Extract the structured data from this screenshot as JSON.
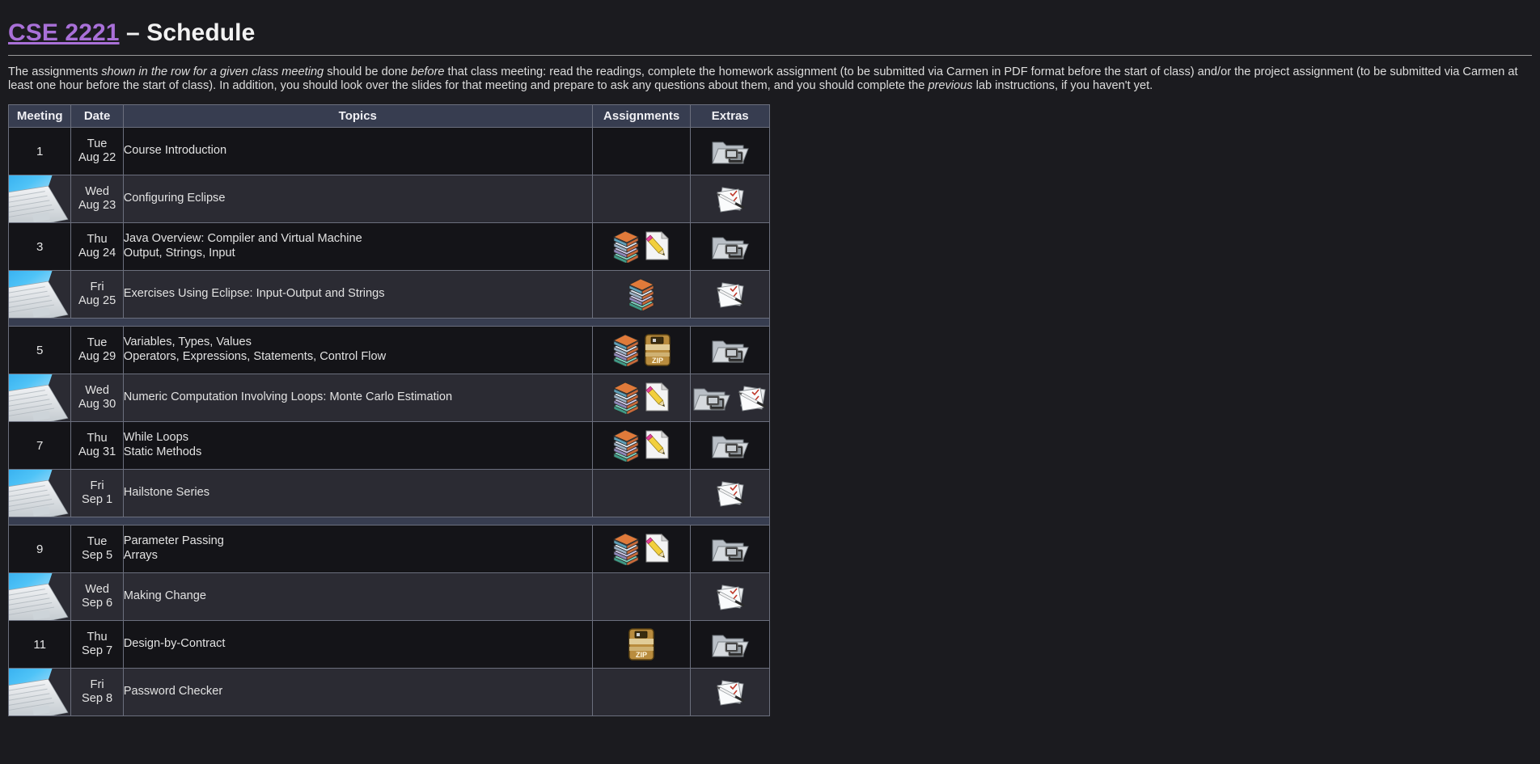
{
  "header": {
    "course_link": "CSE 2221",
    "dash_schedule": " – Schedule"
  },
  "intro": {
    "part1": "The assignments ",
    "em1": "shown in the row for a given class meeting",
    "part2": " should be done ",
    "em2": "before",
    "part3": " that class meeting: read the readings, complete the homework assignment (to be submitted via Carmen in PDF format before the start of class) and/or the project assignment (to be submitted via Carmen at least one hour before the start of class). In addition, you should look over the slides for that meeting and prepare to ask any questions about them, and you should complete the ",
    "em3": "previous",
    "part4": " lab instructions, if you haven't yet."
  },
  "table": {
    "columns": [
      {
        "key": "meeting",
        "label": "Meeting"
      },
      {
        "key": "date",
        "label": "Date"
      },
      {
        "key": "topics",
        "label": "Topics"
      },
      {
        "key": "assignments",
        "label": "Assignments"
      },
      {
        "key": "extras",
        "label": "Extras"
      }
    ],
    "rows": [
      {
        "kind": "class",
        "meeting": "1",
        "meeting_icon": null,
        "date_day": "Tue",
        "date_date": "Aug 22",
        "topics": [
          "Course Introduction"
        ],
        "assignments": [],
        "extras": [
          "slides-folder-icon"
        ]
      },
      {
        "kind": "lab",
        "meeting": "",
        "meeting_icon": "laptop-icon",
        "date_day": "Wed",
        "date_date": "Aug 23",
        "topics": [
          "Configuring Eclipse"
        ],
        "assignments": [],
        "extras": [
          "lab-instructions-icon"
        ]
      },
      {
        "kind": "class",
        "meeting": "3",
        "meeting_icon": null,
        "date_day": "Thu",
        "date_date": "Aug 24",
        "topics": [
          "Java Overview: Compiler and Virtual Machine",
          "Output, Strings, Input"
        ],
        "assignments": [
          "readings-books-icon",
          "homework-pencil-icon"
        ],
        "extras": [
          "slides-folder-icon"
        ]
      },
      {
        "kind": "lab",
        "meeting": "",
        "meeting_icon": "laptop-icon",
        "date_day": "Fri",
        "date_date": "Aug 25",
        "topics": [
          "Exercises Using Eclipse: Input-Output and Strings"
        ],
        "assignments": [
          "readings-books-icon"
        ],
        "extras": [
          "lab-instructions-icon"
        ]
      },
      {
        "kind": "separator"
      },
      {
        "kind": "class",
        "meeting": "5",
        "meeting_icon": null,
        "date_day": "Tue",
        "date_date": "Aug 29",
        "topics": [
          "Variables, Types, Values",
          "Operators, Expressions, Statements, Control Flow"
        ],
        "assignments": [
          "readings-books-icon",
          "zip-archive-icon"
        ],
        "extras": [
          "slides-folder-icon"
        ]
      },
      {
        "kind": "lab",
        "meeting": "",
        "meeting_icon": "laptop-icon",
        "date_day": "Wed",
        "date_date": "Aug 30",
        "topics": [
          "Numeric Computation Involving Loops: Monte Carlo Estimation"
        ],
        "assignments": [
          "readings-books-icon",
          "homework-pencil-icon"
        ],
        "extras": [
          "slides-folder-icon",
          "lab-instructions-icon"
        ]
      },
      {
        "kind": "class",
        "meeting": "7",
        "meeting_icon": null,
        "date_day": "Thu",
        "date_date": "Aug 31",
        "topics": [
          "While Loops",
          "Static Methods"
        ],
        "assignments": [
          "readings-books-icon",
          "homework-pencil-icon"
        ],
        "extras": [
          "slides-folder-icon"
        ]
      },
      {
        "kind": "lab",
        "meeting": "",
        "meeting_icon": "laptop-icon",
        "date_day": "Fri",
        "date_date": "Sep 1",
        "topics": [
          "Hailstone Series"
        ],
        "assignments": [],
        "extras": [
          "lab-instructions-icon"
        ]
      },
      {
        "kind": "separator"
      },
      {
        "kind": "class",
        "meeting": "9",
        "meeting_icon": null,
        "date_day": "Tue",
        "date_date": "Sep 5",
        "topics": [
          "Parameter Passing",
          "Arrays"
        ],
        "assignments": [
          "readings-books-icon",
          "homework-pencil-icon"
        ],
        "extras": [
          "slides-folder-icon"
        ]
      },
      {
        "kind": "lab",
        "meeting": "",
        "meeting_icon": "laptop-icon",
        "date_day": "Wed",
        "date_date": "Sep 6",
        "topics": [
          "Making Change"
        ],
        "assignments": [],
        "extras": [
          "lab-instructions-icon"
        ]
      },
      {
        "kind": "class",
        "meeting": "11",
        "meeting_icon": null,
        "date_day": "Thu",
        "date_date": "Sep 7",
        "topics": [
          "Design-by-Contract"
        ],
        "assignments": [
          "zip-archive-icon"
        ],
        "extras": [
          "slides-folder-icon"
        ]
      },
      {
        "kind": "lab",
        "meeting": "",
        "meeting_icon": "laptop-icon",
        "date_day": "Fri",
        "date_date": "Sep 8",
        "topics": [
          "Password Checker"
        ],
        "assignments": [],
        "extras": [
          "lab-instructions-icon"
        ]
      }
    ]
  },
  "colors": {
    "page_background": "#1b1b1f",
    "link_purple": "#a970d8",
    "header_row": "#373d50",
    "class_row": "#141418",
    "lab_row": "#2b2b33",
    "grid_line": "#6b6f7d",
    "text": "#e2e2e2",
    "zip_gold": "#b98c3e"
  }
}
